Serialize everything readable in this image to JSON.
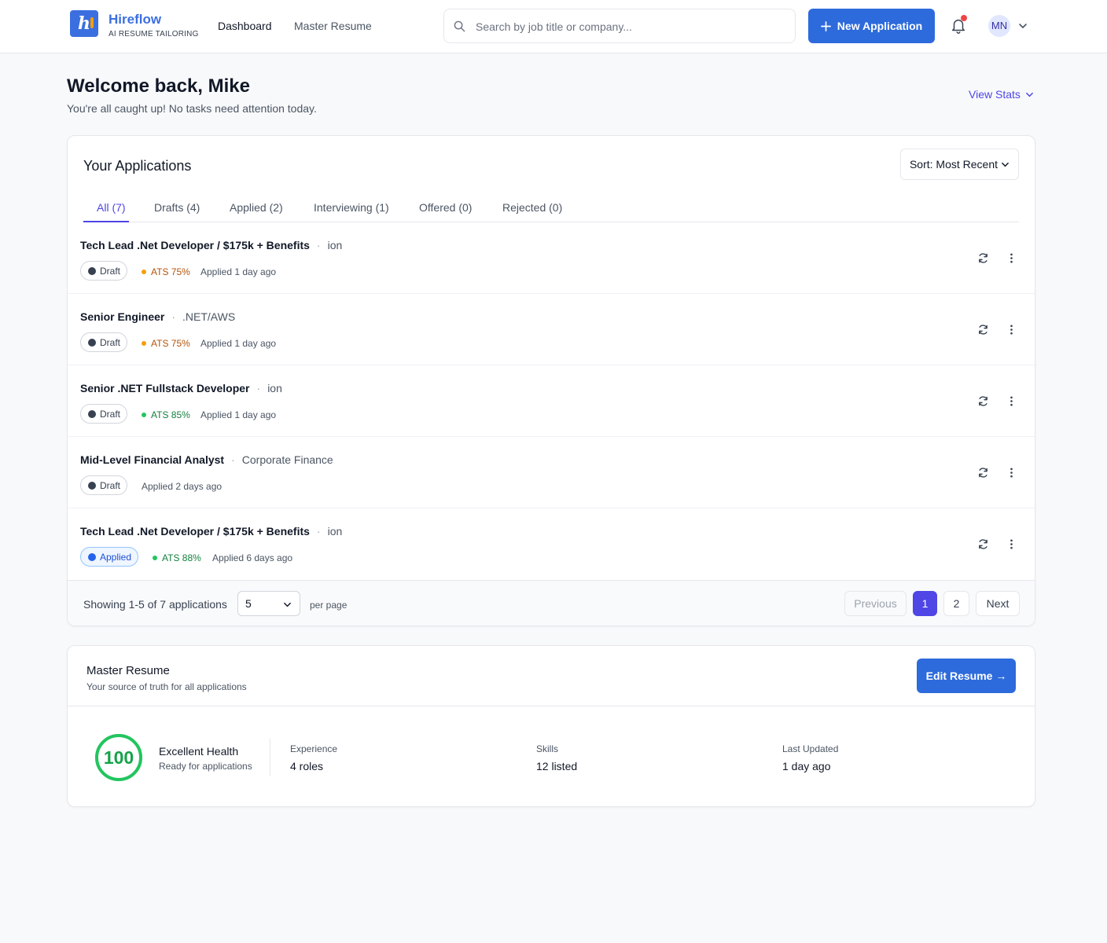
{
  "brand": {
    "name": "Hireflow",
    "tagline": "AI RESUME TAILORING",
    "logo_letter": "h"
  },
  "nav": {
    "dashboard": "Dashboard",
    "master_resume": "Master Resume"
  },
  "search": {
    "placeholder": "Search by job title or company...",
    "value": ""
  },
  "header": {
    "new_application": "New Application",
    "user_initials": "MN"
  },
  "welcome": {
    "title": "Welcome back, Mike",
    "subtitle": "You're all caught up! No tasks need attention today.",
    "view_stats": "View Stats"
  },
  "applications": {
    "title": "Your Applications",
    "sort_label": "Sort: Most Recent",
    "tabs": [
      {
        "label": "All (7)"
      },
      {
        "label": "Drafts (4)"
      },
      {
        "label": "Applied (2)"
      },
      {
        "label": "Interviewing (1)"
      },
      {
        "label": "Offered (0)"
      },
      {
        "label": "Rejected (0)"
      }
    ],
    "rows": [
      {
        "title": "Tech Lead .Net Developer / $175k + Benefits",
        "company": "ion",
        "status": "Draft",
        "ats": "ATS 75%",
        "ats_color": "#b45309",
        "ats_dot": "#f59e0b",
        "applied": "Applied 1 day ago"
      },
      {
        "title": "Senior Engineer",
        "company": ".NET/AWS",
        "status": "Draft",
        "ats": "ATS 75%",
        "ats_color": "#b45309",
        "ats_dot": "#f59e0b",
        "applied": "Applied 1 day ago"
      },
      {
        "title": "Senior .NET Fullstack Developer",
        "company": "ion",
        "status": "Draft",
        "ats": "ATS 85%",
        "ats_color": "#15803d",
        "ats_dot": "#22c55e",
        "applied": "Applied 1 day ago"
      },
      {
        "title": "Mid-Level Financial Analyst",
        "company": "Corporate Finance",
        "status": "Draft",
        "ats": "",
        "applied": "Applied 2 days ago"
      },
      {
        "title": "Tech Lead .Net Developer / $175k + Benefits",
        "company": "ion",
        "status": "Applied",
        "ats": "ATS 88%",
        "ats_color": "#15803d",
        "ats_dot": "#22c55e",
        "applied": "Applied 6 days ago"
      }
    ],
    "footer": {
      "showing": "Showing 1-5 of 7 applications",
      "per_page_value": "5",
      "per_page_label": "per page",
      "previous": "Previous",
      "pages": [
        "1",
        "2"
      ],
      "next": "Next"
    }
  },
  "resume": {
    "title": "Master Resume",
    "subtitle": "Your source of truth for all applications",
    "edit_button": "Edit Resume →",
    "score": "100",
    "score_fraction": 1.0,
    "health_title": "Excellent Health",
    "health_sub": "Ready for applications",
    "stats": [
      {
        "label": "Experience",
        "value": "4 roles"
      },
      {
        "label": "Skills",
        "value": "12 listed"
      },
      {
        "label": "Last Updated",
        "value": "1 day ago"
      }
    ]
  },
  "colors": {
    "primary": "#2d6bdc",
    "accent": "#4f46e5",
    "success": "#22c55e",
    "warning": "#f59e0b",
    "alert": "#ef4444"
  }
}
